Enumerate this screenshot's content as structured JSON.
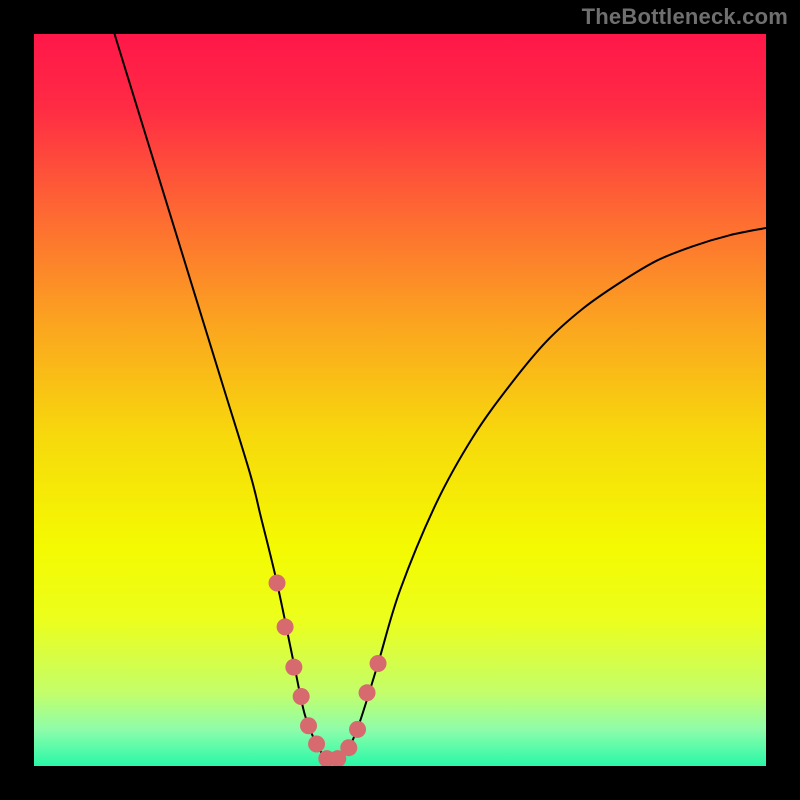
{
  "watermark": "TheBottleneck.com",
  "colors": {
    "page_bg": "#000000",
    "curve_stroke": "#000000",
    "marker_fill": "#d76a6e",
    "gradient_stops": [
      {
        "offset": 0.0,
        "color": "#ff1749"
      },
      {
        "offset": 0.1,
        "color": "#ff2b44"
      },
      {
        "offset": 0.25,
        "color": "#fe6b32"
      },
      {
        "offset": 0.4,
        "color": "#fba61f"
      },
      {
        "offset": 0.55,
        "color": "#f7d90c"
      },
      {
        "offset": 0.7,
        "color": "#f4fa01"
      },
      {
        "offset": 0.8,
        "color": "#ecfe1c"
      },
      {
        "offset": 0.9,
        "color": "#c3fe6a"
      },
      {
        "offset": 0.95,
        "color": "#8efdaa"
      },
      {
        "offset": 1.0,
        "color": "#28f8a8"
      }
    ]
  },
  "chart_data": {
    "type": "line",
    "title": "",
    "xlabel": "",
    "ylabel": "",
    "xlim": [
      0,
      100
    ],
    "ylim": [
      0,
      100
    ],
    "series": [
      {
        "name": "curve",
        "x": [
          11.0,
          14.7,
          18.4,
          22.1,
          25.8,
          29.5,
          31.0,
          33.2,
          35.5,
          37.0,
          38.6,
          40.0,
          41.5,
          43.0,
          44.5,
          47.0,
          50.0,
          55.0,
          60.0,
          65.0,
          70.0,
          75.0,
          80.0,
          85.0,
          90.0,
          95.0,
          100.0
        ],
        "y": [
          100.0,
          88.0,
          76.0,
          64.0,
          52.0,
          40.0,
          34.0,
          25.0,
          14.0,
          7.0,
          3.0,
          1.0,
          1.0,
          2.5,
          6.0,
          14.0,
          24.0,
          36.0,
          45.0,
          52.0,
          58.0,
          62.5,
          66.0,
          69.0,
          71.0,
          72.5,
          73.5
        ]
      }
    ],
    "markers": {
      "name": "highlighted-points",
      "x": [
        33.2,
        34.3,
        35.5,
        36.5,
        37.5,
        38.6,
        40.0,
        41.5,
        43.0,
        44.2,
        45.5,
        47.0
      ],
      "y": [
        25.0,
        19.0,
        13.5,
        9.5,
        5.5,
        3.0,
        1.0,
        1.0,
        2.5,
        5.0,
        10.0,
        14.0
      ]
    }
  }
}
